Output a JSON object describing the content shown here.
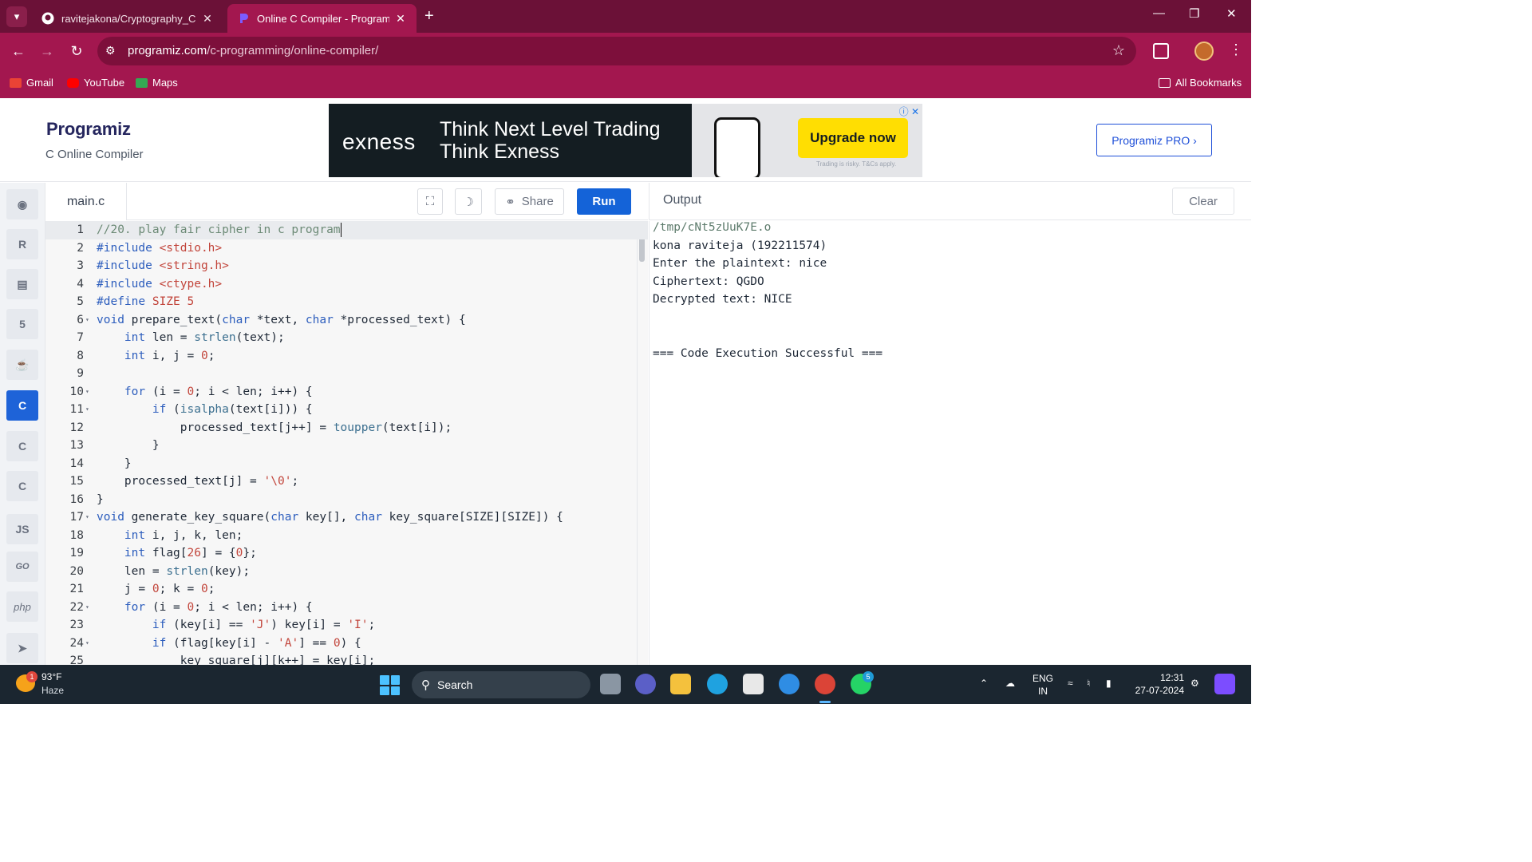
{
  "browser": {
    "tabs": [
      {
        "title": "ravitejakona/Cryptography_CSA",
        "active": false
      },
      {
        "title": "Online C Compiler - Programiz",
        "active": true
      }
    ],
    "url_host": "programiz.com",
    "url_path": "/c-programming/online-compiler/",
    "bookmarks": [
      "Gmail",
      "YouTube",
      "Maps"
    ],
    "all_bookmarks": "All Bookmarks",
    "accent": "#a3174f"
  },
  "header": {
    "logo": "Programiz",
    "subtitle": "C Online Compiler",
    "pro_button": "Programiz PRO ›"
  },
  "ad": {
    "brand": "exness",
    "tagline_1": "Think Next Level Trading",
    "tagline_2": "Think Exness",
    "cta": "Upgrade now",
    "disclaimer": "Trading is risky. T&Cs apply."
  },
  "sidebar": {
    "languages": [
      "python-icon",
      "r-icon",
      "sql-icon",
      "html-icon",
      "java-icon",
      "c-icon",
      "cpp-icon",
      "csharp-icon",
      "js-icon",
      "go-icon",
      "php-icon",
      "swift-icon"
    ],
    "js_label": "JS",
    "php_label": "php",
    "go_label": "GO",
    "active": "c-icon"
  },
  "editor": {
    "file_name": "main.c",
    "share_label": "Share",
    "run_label": "Run",
    "line_numbers": [
      "1",
      "2",
      "3",
      "4",
      "5",
      "6",
      "7",
      "8",
      "9",
      "10",
      "11",
      "12",
      "13",
      "14",
      "15",
      "16",
      "17",
      "18",
      "19",
      "20",
      "21",
      "22",
      "23",
      "24",
      "25"
    ]
  },
  "output": {
    "title": "Output",
    "clear_label": "Clear",
    "lines": [
      "/tmp/cNt5zUuK7E.o",
      "kona raviteja (192211574)",
      "Enter the plaintext: nice",
      "Ciphertext: QGDO",
      "Decrypted text: NICE",
      "=== Code Execution Successful ==="
    ]
  },
  "taskbar": {
    "temperature": "93°F",
    "condition": "Haze",
    "weather_badge": "1",
    "search_label": "Search",
    "whatsapp_badge": "5",
    "lang_1": "ENG",
    "lang_2": "IN",
    "time": "12:31",
    "date": "27-07-2024"
  }
}
